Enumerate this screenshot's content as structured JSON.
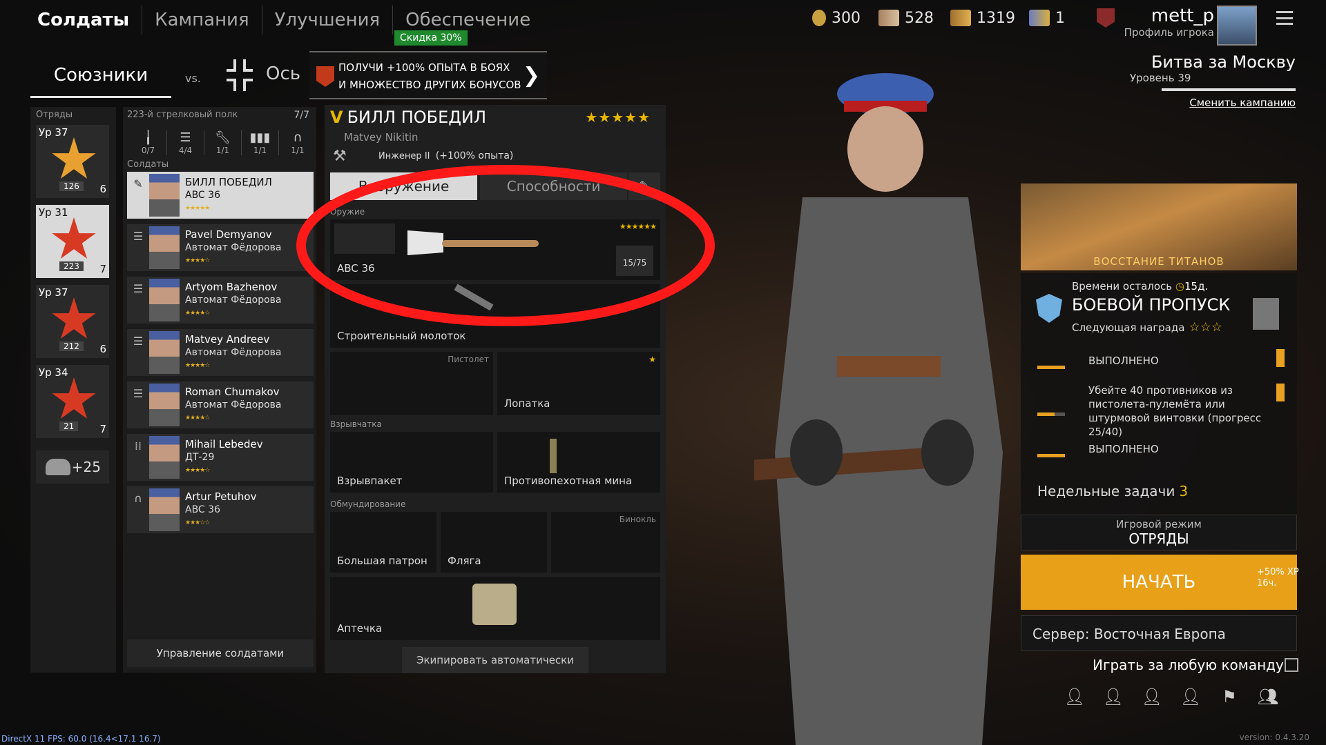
{
  "nav": {
    "tabs": [
      "Солдаты",
      "Кампания",
      "Улучшения",
      "Обеспечение"
    ],
    "discount": "Скидка 30%"
  },
  "resources": [
    {
      "icon": "coin-icon",
      "value": "300"
    },
    {
      "icon": "silver-tickets-icon",
      "value": "528"
    },
    {
      "icon": "gold-tickets-icon",
      "value": "1319"
    },
    {
      "icon": "premium-tickets-icon",
      "value": "1"
    }
  ],
  "user": {
    "name": "mett_p",
    "profile": "Профиль игрока"
  },
  "sides": {
    "allies": "Союзники",
    "vs": "vs.",
    "axis": "Ось"
  },
  "promo": {
    "line1": "ПОЛУЧИ +100% ОПЫТА В БОЯХ",
    "line2": "И МНОЖЕСТВО ДРУГИХ БОНУСОВ"
  },
  "squads": {
    "label": "Отряды",
    "items": [
      {
        "level": "Ур 37",
        "badge": "126",
        "count": "6",
        "icon": "tank-icon"
      },
      {
        "level": "Ур 31",
        "badge": "223",
        "count": "7",
        "icon": "rifle-icon",
        "selected": true
      },
      {
        "level": "Ур 37",
        "badge": "212",
        "count": "6",
        "icon": "wrench-icon"
      },
      {
        "level": "Ур 34",
        "badge": "21",
        "count": "7",
        "icon": "rifle-icon"
      }
    ],
    "extra": "+25"
  },
  "soldiers": {
    "regiment": "223-й стрелковый полк",
    "count": "7/7",
    "label": "Солдаты",
    "roles": [
      {
        "icon": "bayonet-icon",
        "value": "0/7"
      },
      {
        "icon": "list-icon",
        "value": "4/4"
      },
      {
        "icon": "wrench-icon",
        "value": "1/1"
      },
      {
        "icon": "group-icon",
        "value": "1/1"
      },
      {
        "icon": "headset-icon",
        "value": "1/1"
      }
    ],
    "list": [
      {
        "name": "БИЛЛ ПОБЕДИЛ",
        "weapon": "ABC 36",
        "stars": "★★★★★",
        "cls": "wrench-icon",
        "selected": true
      },
      {
        "name": "Pavel Demyanov",
        "weapon": "Автомат Фёдорова",
        "stars": "★★★★☆",
        "cls": "list-icon"
      },
      {
        "name": "Artyom Bazhenov",
        "weapon": "Автомат Фёдорова",
        "stars": "★★★★☆",
        "cls": "list-icon"
      },
      {
        "name": "Matvey Andreev",
        "weapon": "Автомат Фёдорова",
        "stars": "★★★★☆",
        "cls": "list-icon"
      },
      {
        "name": "Roman Chumakov",
        "weapon": "Автомат Фёдорова",
        "stars": "★★★★☆",
        "cls": "list-icon"
      },
      {
        "name": "Mihail Lebedev",
        "weapon": "ДТ-29",
        "stars": "★★★★☆",
        "cls": "group-icon"
      },
      {
        "name": "Artur Petuhov",
        "weapon": "ABC 36",
        "stars": "★★★☆☆",
        "cls": "headset-icon"
      }
    ],
    "manage": "Управление солдатами"
  },
  "equip": {
    "name": "БИЛЛ ПОБЕДИЛ",
    "rank_letter": "V",
    "stars": "★★★★★",
    "subname": "Matvey Nikitin",
    "rank": "Инженер II",
    "bonus": "(+100% опыта)",
    "tabs": [
      "Вооружение",
      "Способности"
    ],
    "cat_weapon": "Оружие",
    "primary": "ABC 36",
    "ammo": "15/75",
    "primary_stars": "★★★★★★",
    "tool": "Строительный молоток",
    "pistol_label": "Пистолет",
    "shovel": "Лопатка",
    "cat_explosive": "Взрывчатка",
    "explosive1": "Взрывпакет",
    "explosive2": "Противопехотная мина",
    "cat_gear": "Обмундирование",
    "gear1": "Большая патрон",
    "gear2": "Фляга",
    "binoc_label": "Бинокль",
    "medkit": "Аптечка",
    "auto": "Экипировать автоматически"
  },
  "campaign": {
    "name": "Битва за Москву",
    "level": "Уровень 39",
    "change": "Сменить кампанию"
  },
  "event": {
    "banner": "ВОССТАНИЕ ТИТАНОВ"
  },
  "battlepass": {
    "time_label": "Времени осталось",
    "time": "15д.",
    "title": "БОЕВОЙ ПРОПУСК",
    "next": "Следующая награда",
    "next_stars": "☆☆☆",
    "tasks": [
      {
        "text": "ВЫПОЛНЕНО"
      },
      {
        "text": "Убейте 40 противников из пистолета-пулемёта или штурмовой винтовки (прогресс 25/40)"
      },
      {
        "text": "ВЫПОЛНЕНО"
      }
    ]
  },
  "weekly": {
    "label": "Недельные задачи",
    "count": "3"
  },
  "mode": {
    "label": "Игровой режим",
    "value": "ОТРЯДЫ"
  },
  "start": {
    "label": "НАЧАТЬ",
    "xp": "+50% XP",
    "time": "16ч."
  },
  "server": {
    "label": "Сервер: Восточная Европа"
  },
  "anyteam": {
    "label": "Играть за любую команду"
  },
  "debug": "DirectX 11 FPS: 60.0 (16.4<17.1 16.7)",
  "version": "version: 0.4.3.20",
  "colors": {
    "accent": "#e8a018",
    "discount": "#1f8a2d",
    "star": "#e8b800",
    "annotation": "#ff1a1a"
  }
}
